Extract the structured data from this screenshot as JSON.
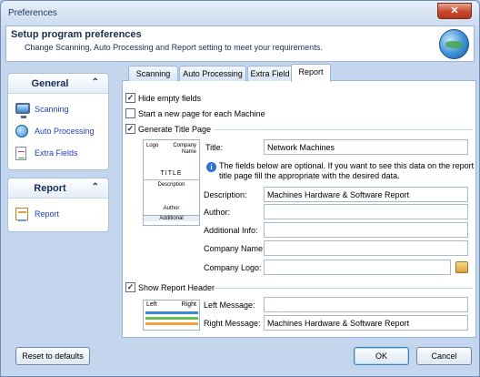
{
  "window": {
    "title": "Preferences",
    "close_glyph": "✕"
  },
  "header": {
    "title": "Setup program preferences",
    "subtitle": "Change Scanning, Auto Processing and Report setting to meet your requirements."
  },
  "sidebar": {
    "general": {
      "title": "General",
      "chevron": "⌃",
      "items": [
        {
          "label": "Scanning",
          "icon": "monitor-icon"
        },
        {
          "label": "Auto Processing",
          "icon": "globe-icon"
        },
        {
          "label": "Extra Fields",
          "icon": "document-icon"
        }
      ]
    },
    "report": {
      "title": "Report",
      "chevron": "⌃",
      "items": [
        {
          "label": "Report",
          "icon": "report-icon"
        }
      ]
    }
  },
  "tabs": [
    {
      "label": "Scanning"
    },
    {
      "label": "Auto Processing"
    },
    {
      "label": "Extra Field"
    },
    {
      "label": "Report",
      "active": true
    }
  ],
  "report": {
    "hide_empty_fields": {
      "label": "Hide empty fields",
      "checked": true
    },
    "new_page_per_machine": {
      "label": "Start a new page for each Machine",
      "checked": false
    },
    "generate_title_page": {
      "label": "Generate Title Page",
      "checked": true
    },
    "title_preview": {
      "logo": "Logo",
      "company_line1": "Company",
      "company_line2": "Name",
      "title": "TITLE",
      "description": "Description",
      "author": "Author",
      "additional": "Additional"
    },
    "title_label": "Title:",
    "title_value": "Network Machines",
    "info_icon": "i",
    "info_line1": "The fields below are optional. If you want to see this data on the report",
    "info_line2": "title page fill the appropriate with the desired data.",
    "description_label": "Description:",
    "description_value": "Machines Hardware & Software Report",
    "author_label": "Author:",
    "author_value": "",
    "additional_label": "Additional Info:",
    "additional_value": "",
    "company_name_label": "Company Name:",
    "company_name_value": "",
    "company_logo_label": "Company Logo:",
    "company_logo_value": "",
    "show_report_header": {
      "label": "Show Report Header",
      "checked": true
    },
    "header_preview": {
      "left": "Left",
      "right": "Right"
    },
    "left_message_label": "Left Message:",
    "left_message_value": "",
    "right_message_label": "Right Message:",
    "right_message_value": "Machines Hardware & Software Report"
  },
  "footer": {
    "reset_label": "Reset to defaults",
    "ok_label": "OK",
    "cancel_label": "Cancel"
  },
  "colors": {
    "accent": "#1f3fbf",
    "window_bg": "#c3d6ee",
    "close": "#c7462b"
  }
}
